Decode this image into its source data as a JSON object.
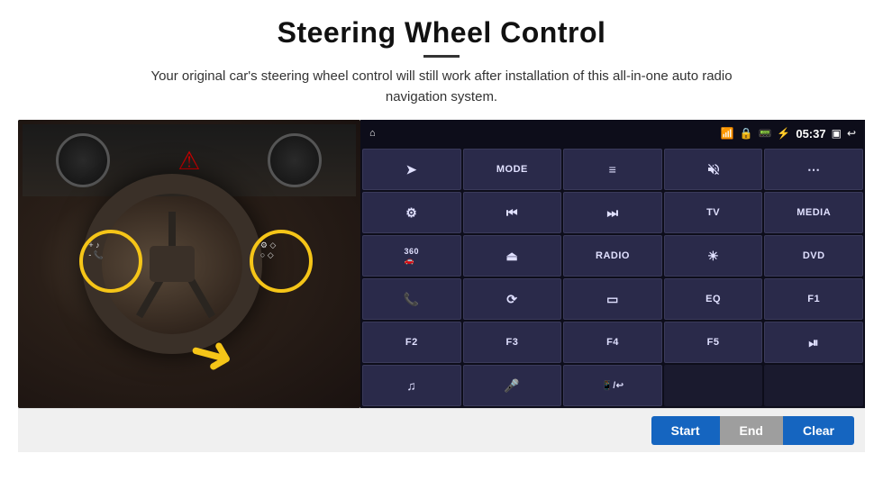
{
  "page": {
    "title": "Steering Wheel Control",
    "subtitle": "Your original car's steering wheel control will still work after installation of this all-in-one auto radio navigation system."
  },
  "status_bar": {
    "time": "05:37",
    "icons": [
      "wifi",
      "lock",
      "sim",
      "bluetooth",
      "battery",
      "screen-mirror",
      "back"
    ]
  },
  "ui_buttons": [
    {
      "id": "home",
      "type": "icon",
      "symbol": "⌂",
      "row": 1,
      "col": 1
    },
    {
      "id": "navigate",
      "type": "icon",
      "symbol": "➤",
      "row": 1,
      "col": 2
    },
    {
      "id": "mode",
      "type": "text",
      "label": "MODE",
      "row": 1,
      "col": 3
    },
    {
      "id": "list",
      "type": "icon",
      "symbol": "≡",
      "row": 1,
      "col": 4
    },
    {
      "id": "mute",
      "type": "icon",
      "symbol": "🔇",
      "row": 1,
      "col": 5
    },
    {
      "id": "apps",
      "type": "icon",
      "symbol": "⋯",
      "row": 1,
      "col": 6
    },
    {
      "id": "settings",
      "type": "icon",
      "symbol": "⚙",
      "row": 2,
      "col": 1
    },
    {
      "id": "prev",
      "type": "icon",
      "symbol": "⏮",
      "row": 2,
      "col": 2
    },
    {
      "id": "next",
      "type": "icon",
      "symbol": "⏭",
      "row": 2,
      "col": 3
    },
    {
      "id": "tv",
      "type": "text",
      "label": "TV",
      "row": 2,
      "col": 4
    },
    {
      "id": "media",
      "type": "text",
      "label": "MEDIA",
      "row": 2,
      "col": 5
    },
    {
      "id": "cam360",
      "type": "icon",
      "symbol": "360",
      "row": 3,
      "col": 1
    },
    {
      "id": "eject",
      "type": "icon",
      "symbol": "⏏",
      "row": 3,
      "col": 2
    },
    {
      "id": "radio",
      "type": "text",
      "label": "RADIO",
      "row": 3,
      "col": 3
    },
    {
      "id": "brightness",
      "type": "icon",
      "symbol": "☀",
      "row": 3,
      "col": 4
    },
    {
      "id": "dvd",
      "type": "text",
      "label": "DVD",
      "row": 3,
      "col": 5
    },
    {
      "id": "phone",
      "type": "icon",
      "symbol": "📞",
      "row": 4,
      "col": 1
    },
    {
      "id": "swipe",
      "type": "icon",
      "symbol": "⟳",
      "row": 4,
      "col": 2
    },
    {
      "id": "display",
      "type": "icon",
      "symbol": "▭",
      "row": 4,
      "col": 3
    },
    {
      "id": "eq",
      "type": "text",
      "label": "EQ",
      "row": 4,
      "col": 4
    },
    {
      "id": "f1",
      "type": "text",
      "label": "F1",
      "row": 4,
      "col": 5
    },
    {
      "id": "f2",
      "type": "text",
      "label": "F2",
      "row": 5,
      "col": 1
    },
    {
      "id": "f3",
      "type": "text",
      "label": "F3",
      "row": 5,
      "col": 2
    },
    {
      "id": "f4",
      "type": "text",
      "label": "F4",
      "row": 5,
      "col": 3
    },
    {
      "id": "f5",
      "type": "text",
      "label": "F5",
      "row": 5,
      "col": 4
    },
    {
      "id": "playpause",
      "type": "icon",
      "symbol": "⏯",
      "row": 5,
      "col": 5
    },
    {
      "id": "music",
      "type": "icon",
      "symbol": "♫",
      "row": 6,
      "col": 1
    },
    {
      "id": "mic",
      "type": "icon",
      "symbol": "🎤",
      "row": 6,
      "col": 2
    },
    {
      "id": "volphone",
      "type": "icon",
      "symbol": "📱",
      "row": 6,
      "col": 3
    }
  ],
  "bottom_buttons": {
    "start": "Start",
    "end": "End",
    "clear": "Clear"
  },
  "colors": {
    "primary_blue": "#1565C0",
    "panel_dark": "#1a1a2e",
    "btn_bg": "#2a2a4a",
    "btn_border": "#3a3a5a",
    "status_bar_bg": "#0d0d1a",
    "gray_btn": "#9e9e9e"
  }
}
